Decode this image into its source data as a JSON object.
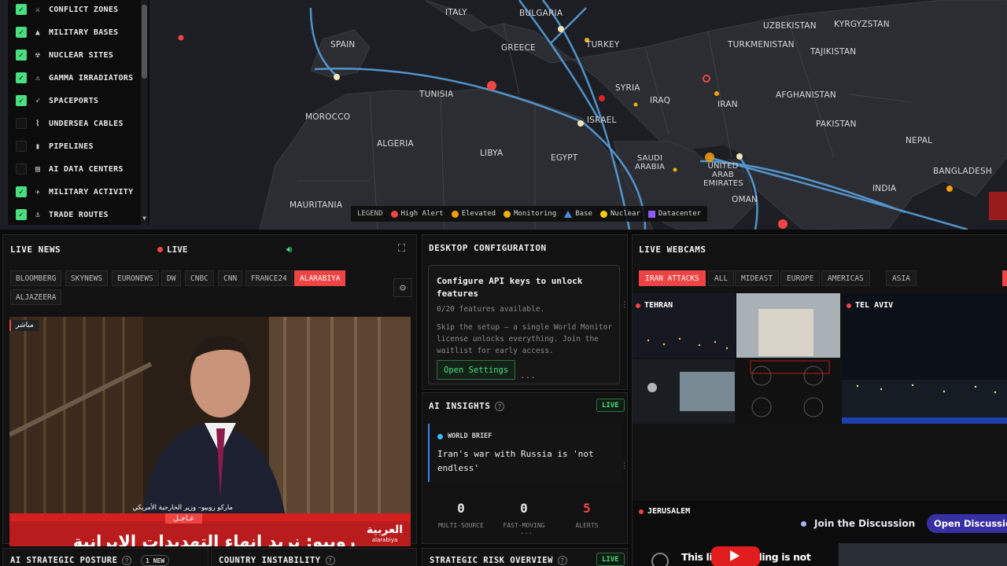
{
  "map": {
    "countries": [
      "SPAIN",
      "ITALY",
      "BULGARIA",
      "GREECE",
      "TURKEY",
      "UZBEKISTAN",
      "KYRGYZSTAN",
      "TURKMENISTAN",
      "TAJIKISTAN",
      "TUNISIA",
      "SYRIA",
      "IRAQ",
      "IRAN",
      "AFGHANISTAN",
      "MOROCCO",
      "ISRAEL",
      "PAKISTAN",
      "ALGERIA",
      "LIBYA",
      "EGYPT",
      "NEPAL",
      "SAUDI ARABIA",
      "UNITED ARAB EMIRATES",
      "BANGLADESH",
      "INDIA",
      "MAURITANIA",
      "OMAN"
    ],
    "layers": [
      {
        "label": "CONFLICT ZONES",
        "checked": true,
        "icon": "crossed-swords-icon",
        "glyph": "⚔"
      },
      {
        "label": "MILITARY BASES",
        "checked": true,
        "icon": "base-icon",
        "glyph": "▲"
      },
      {
        "label": "NUCLEAR SITES",
        "checked": true,
        "icon": "radiation-icon",
        "glyph": "☢"
      },
      {
        "label": "GAMMA IRRADIATORS",
        "checked": true,
        "icon": "warning-icon",
        "glyph": "⚠"
      },
      {
        "label": "SPACEPORTS",
        "checked": true,
        "icon": "rocket-icon",
        "glyph": "➶"
      },
      {
        "label": "UNDERSEA CABLES",
        "checked": false,
        "icon": "cable-icon",
        "glyph": "⌇"
      },
      {
        "label": "PIPELINES",
        "checked": false,
        "icon": "pipeline-icon",
        "glyph": "▮"
      },
      {
        "label": "AI DATA CENTERS",
        "checked": false,
        "icon": "server-icon",
        "glyph": "▤"
      },
      {
        "label": "MILITARY ACTIVITY",
        "checked": true,
        "icon": "plane-icon",
        "glyph": "✈"
      },
      {
        "label": "TRADE ROUTES",
        "checked": true,
        "icon": "anchor-icon",
        "glyph": "⚓"
      }
    ],
    "legend": {
      "title": "LEGEND",
      "items": [
        {
          "label": "High Alert",
          "shape": "dot",
          "color": "#ef4444"
        },
        {
          "label": "Elevated",
          "shape": "dot",
          "color": "#f59e0b"
        },
        {
          "label": "Monitoring",
          "shape": "dot",
          "color": "#eab308"
        },
        {
          "label": "Base",
          "shape": "triangle",
          "color": "#4a90e2"
        },
        {
          "label": "Nuclear",
          "shape": "dot",
          "color": "#facc15"
        },
        {
          "label": "Datacenter",
          "shape": "square",
          "color": "#8b5cf6"
        }
      ]
    }
  },
  "news": {
    "title": "LIVE NEWS",
    "live": "LIVE",
    "channels": [
      "BLOOMBERG",
      "SKYNEWS",
      "EURONEWS",
      "DW",
      "CNBC",
      "CNN",
      "FRANCE24",
      "ALARABIYA",
      "ALJAZEERA"
    ],
    "active_channel": "ALARABIYA",
    "video": {
      "live_tag": "مباشر",
      "caption_name": "ماركو روبيو– وزير الخارجية الأمريكي",
      "urgent": "عـاجـل",
      "headline": "روبيو: نريد انهاء التهديدات الايرانية",
      "brand_ar": "العربية",
      "brand_en": "alarabiya"
    }
  },
  "desktop": {
    "title": "DESKTOP CONFIGURATION",
    "heading": "Configure API keys to unlock features",
    "available": "0/20 features available.",
    "description": "Skip the setup — a single World Monitor license unlocks everything. Join the waitlist for early access.",
    "button": "Open Settings"
  },
  "ai": {
    "title": "AI INSIGHTS",
    "badge": "LIVE",
    "brief_label": "WORLD BRIEF",
    "brief_text": "Iran's war with Russia is 'not endless'",
    "stats": [
      {
        "value": "0",
        "label": "MULTI-SOURCE"
      },
      {
        "value": "0",
        "label": "FAST-MOVING"
      },
      {
        "value": "5",
        "label": "ALERTS"
      }
    ]
  },
  "cams": {
    "title": "LIVE WEBCAMS",
    "tabs": [
      "IRAN ATTACKS",
      "ALL",
      "MIDEAST",
      "EUROPE",
      "AMERICAS",
      "ASIA"
    ],
    "active_tab": "IRAN ATTACKS",
    "feeds": [
      "TEHRAN",
      "TEL AVIV",
      "JERUSALEM"
    ],
    "join": "Join the Discussion",
    "open_discussion": "Open Discussion",
    "jerusalem_overlay": "This live recording is not"
  },
  "bottom": {
    "strategic_posture": "AI STRATEGIC POSTURE",
    "new_badge": "1 NEW",
    "country_instability": "COUNTRY INSTABILITY",
    "risk_overview": "STRATEGIC RISK OVERVIEW",
    "risk_badge": "LIVE"
  }
}
